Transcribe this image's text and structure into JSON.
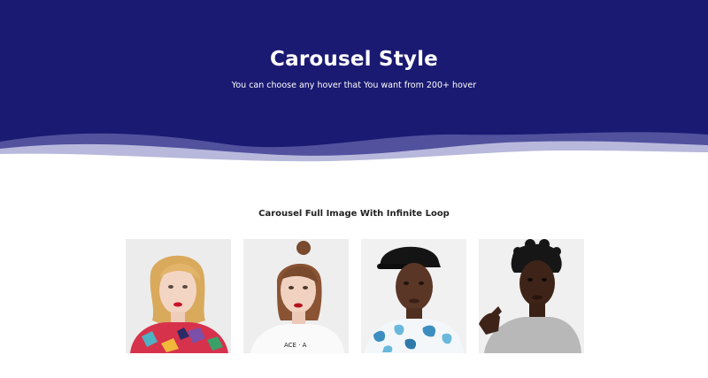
{
  "hero": {
    "title": "Carousel Style",
    "subtitle": "You can choose any hover that You want from 200+ hover",
    "background_color": "#1a1a72"
  },
  "section": {
    "title": "Carousel Full Image With Infinite Loop"
  },
  "carousel": {
    "items": [
      {
        "name": "woman-blonde-floral-top"
      },
      {
        "name": "woman-bun-white-tee"
      },
      {
        "name": "man-black-cap-leaf-shirt"
      },
      {
        "name": "man-curly-hair-grey-tee"
      }
    ]
  }
}
